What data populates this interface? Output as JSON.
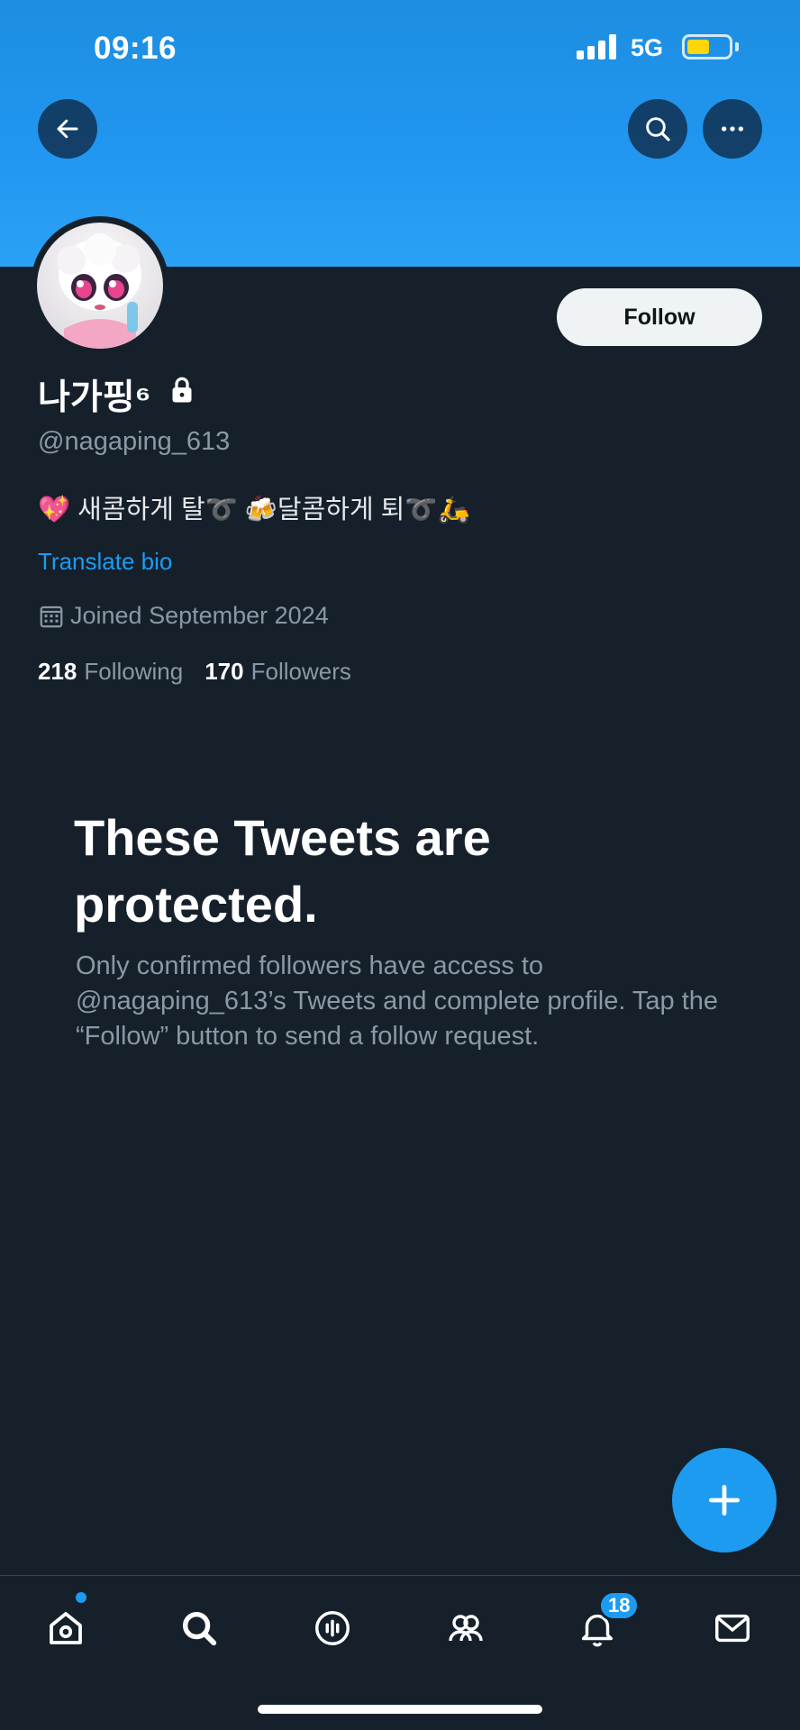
{
  "status_bar": {
    "time": "09:16",
    "network": "5G",
    "battery_level": 0.55
  },
  "header": {
    "back_icon": "arrow-left-icon",
    "search_icon": "search-icon",
    "more_icon": "more-horizontal-icon"
  },
  "profile": {
    "display_name": "나가핑⁶",
    "protected": true,
    "handle": "@nagaping_613",
    "bio": {
      "part1": "💖 새콤하게 탈",
      "curl1": "➰",
      "part2": " 🍻달콤하게 퇴",
      "curl2": "➰",
      "part3": "🛵"
    },
    "translate_label": "Translate bio",
    "joined": "Joined September 2024",
    "following_count": "218",
    "following_label": "Following",
    "followers_count": "170",
    "followers_label": "Followers",
    "follow_button": "Follow"
  },
  "protected_notice": {
    "title": "These Tweets are protected.",
    "body": "Only confirmed followers have access to @nagaping_613’s Tweets and complete profile. Tap the “Follow” button to send a follow request."
  },
  "fab": {
    "icon": "plus-icon"
  },
  "tabbar": {
    "items": [
      {
        "name": "home",
        "icon": "home-icon",
        "has_dot": true
      },
      {
        "name": "search",
        "icon": "search-icon"
      },
      {
        "name": "spaces",
        "icon": "spaces-icon"
      },
      {
        "name": "communities",
        "icon": "communities-icon"
      },
      {
        "name": "notifications",
        "icon": "bell-icon",
        "badge": "18"
      },
      {
        "name": "messages",
        "icon": "mail-icon"
      }
    ]
  },
  "colors": {
    "accent": "#1d9bf0",
    "background": "#15202b",
    "muted": "#8b98a5"
  }
}
